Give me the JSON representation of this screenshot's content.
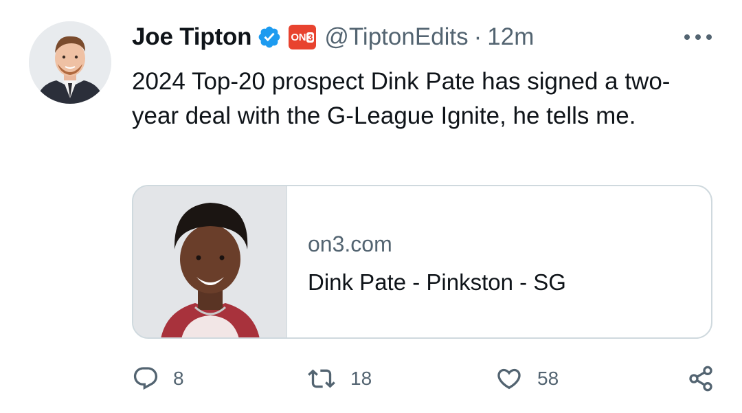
{
  "author": {
    "display_name": "Joe Tipton",
    "handle": "@TiptonEdits",
    "separator": "·",
    "time": "12m",
    "affiliate_badge": {
      "text": "ON",
      "num": "3"
    },
    "verified_color": "#1d9bf0"
  },
  "tweet": {
    "text": "2024 Top-20 prospect Dink Pate has signed a two-year deal with the G-League Ignite, he tells me."
  },
  "card": {
    "domain": "on3.com",
    "title": "Dink Pate - Pinkston - SG"
  },
  "actions": {
    "replies": "8",
    "retweets": "18",
    "likes": "58"
  },
  "icons": [
    "avatar",
    "verified-icon",
    "affiliate-badge",
    "more-icon",
    "reply-icon",
    "retweet-icon",
    "like-icon",
    "share-icon"
  ],
  "colors": {
    "text": "#0f1419",
    "secondary": "#536471",
    "border": "#cfd9de",
    "badge": "#e8432f"
  }
}
